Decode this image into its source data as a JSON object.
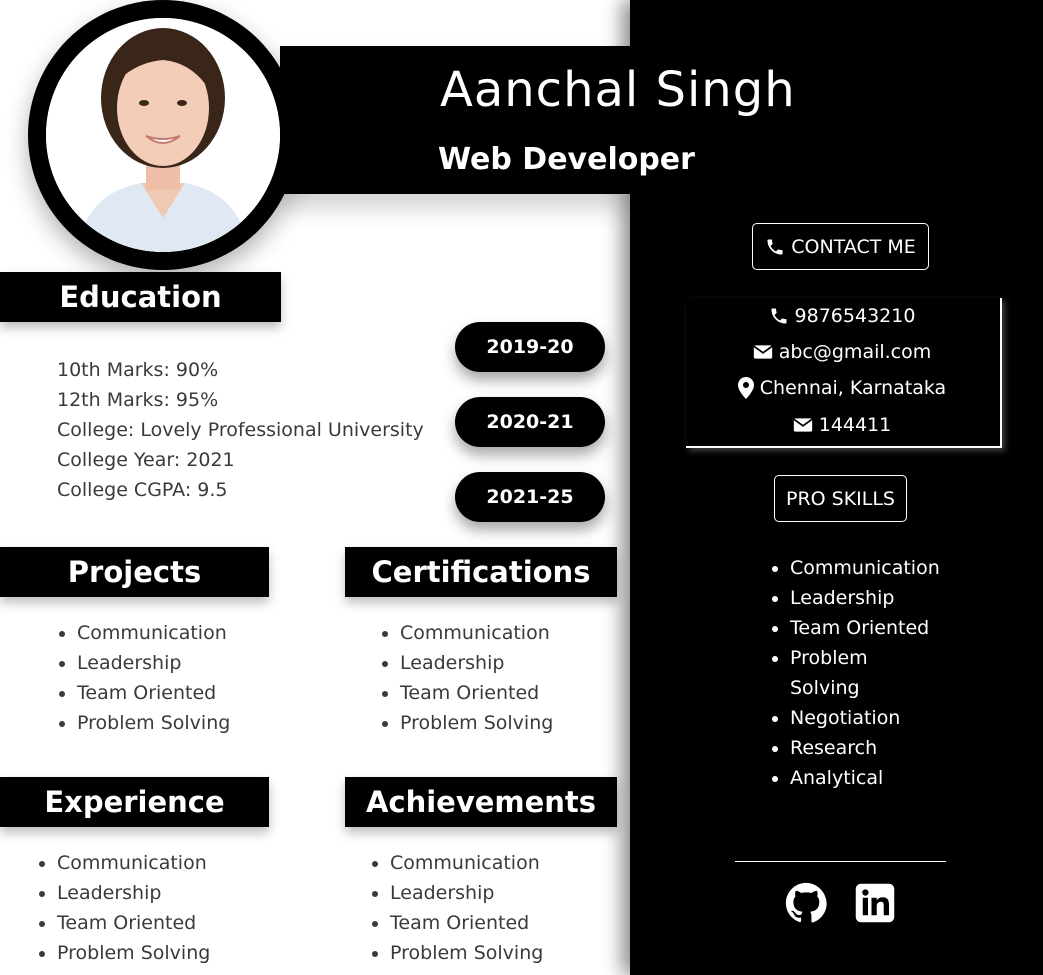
{
  "header": {
    "name": "Aanchal Singh",
    "role": "Web Developer"
  },
  "education": {
    "heading": "Education",
    "items": [
      "10th Marks: 90%",
      "12th Marks: 95%",
      "College: Lovely Professional University",
      "College Year: 2021",
      "College CGPA: 9.5"
    ],
    "years": [
      "2019-20",
      "2020-21",
      "2021-25"
    ]
  },
  "projects": {
    "heading": "Projects",
    "items": [
      "Communication",
      "Leadership",
      "Team Oriented",
      "Problem Solving"
    ]
  },
  "certifications": {
    "heading": "Certifications",
    "items": [
      "Communication",
      "Leadership",
      "Team Oriented",
      "Problem Solving"
    ]
  },
  "experience": {
    "heading": "Experience",
    "items": [
      "Communication",
      "Leadership",
      "Team Oriented",
      "Problem Solving"
    ]
  },
  "achievements": {
    "heading": "Achievements",
    "items": [
      "Communication",
      "Leadership",
      "Team Oriented",
      "Problem Solving"
    ]
  },
  "contact": {
    "button": "CONTACT ME",
    "phone": "9876543210",
    "email": "abc@gmail.com",
    "location": "Chennai, Karnataka",
    "pin": "144411"
  },
  "skills": {
    "button": "PRO SKILLS",
    "items": [
      "Communication",
      "Leadership",
      "Team Oriented",
      "Problem Solving",
      "Negotiation",
      "Research",
      "Analytical"
    ]
  },
  "social": {
    "icons": [
      "github-icon",
      "linkedin-icon"
    ]
  },
  "colors": {
    "panel": "#000000",
    "text": "#3a3a3a",
    "accent": "#ffffff"
  }
}
